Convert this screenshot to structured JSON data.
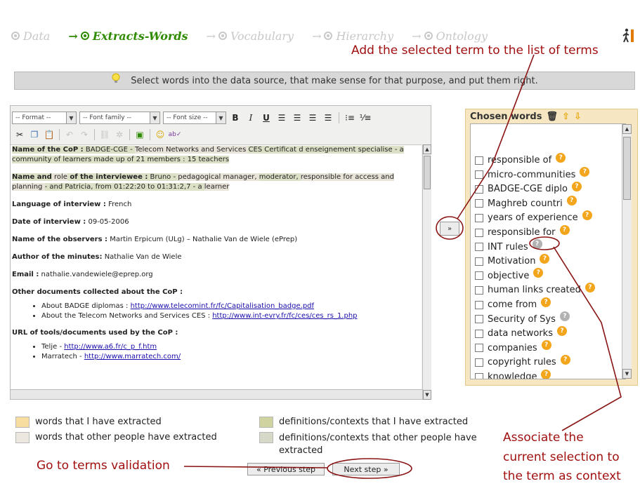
{
  "steps": [
    {
      "label": "Data",
      "arrow": "",
      "active": false
    },
    {
      "label": "Extracts-Words",
      "arrow": "→",
      "active": true
    },
    {
      "label": "Vocabulary",
      "arrow": "→",
      "active": false
    },
    {
      "label": "Hierarchy",
      "arrow": "→",
      "active": false
    },
    {
      "label": "Ontology",
      "arrow": "→",
      "active": false
    }
  ],
  "annotations": {
    "add_term": "Add the selected term to the list of terms",
    "associate_line1": "Associate the",
    "associate_line2": "current selection to",
    "associate_line3": "the term as context",
    "go_validation": "Go to terms validation"
  },
  "hint": {
    "text": "Select words into the data source, that make sense for that purpose, and put them right."
  },
  "editor": {
    "format_select": "-- Format --",
    "font_family_select": "-- Font family --",
    "font_size_select": "-- Font size --",
    "bold": "B",
    "italic": "I",
    "underline": "U"
  },
  "doc": {
    "p1_label": "Name of the CoP :",
    "p1_a": " BADGE-CGE - ",
    "p1_b": " Telecom Networks and Services ",
    "p1_c": " CES Certificat d enseignement specialise - a community of learners made up of 21 members : 15 teachers",
    "p2_label1": "Name and",
    "p2_role": " role",
    "p2_label2": " of the interviewee :",
    "p2_a": " Bruno - ",
    "p2_b": " pedagogical manager, ",
    "p2_c": " moderator, ",
    "p2_d": " responsible for access and planning ",
    "p2_e": " - and Patricia, from 01:22:20 to 01:31:2,7 - a ",
    "p2_f": " learner",
    "p3_label": "Language of interview :",
    "p3_value": " French",
    "p4_label": "Date of interview :",
    "p4_value": " 09-05-2006",
    "p5_label": "Name of the observers :",
    "p5_value": " Martin Erpicum (ULg) – Nathalie Van de Wiele (ePrep)",
    "p6_label": "Author of the minutes:",
    "p6_value": " Nathalie Van de Wiele",
    "p7_label": "Email :",
    "p7_value": " nathalie.vandewiele@eprep.org",
    "p8_label": "Other documents collected about the CoP :",
    "li1_text": "About BADGE diplomas : ",
    "li1_link": "http://www.telecomint.fr/fc/Capitalisation_badge.pdf",
    "li2_text": "About the Telecom Networks and Services CES : ",
    "li2_link": "http://www.int-evry.fr/fc/ces/ces_rs_1.php",
    "p9_label": "URL of tools/documents used by the CoP :",
    "li3_text": "Telje - ",
    "li3_link": "http://www.a6.fr/c_p_f.htm",
    "li4_text": "Marratech - ",
    "li4_link": "http://www.marratech.com/"
  },
  "transfer_button": "»",
  "chosen": {
    "title": "Chosen words",
    "words": [
      {
        "label": "responsible of",
        "icon": "orange"
      },
      {
        "label": "micro-communities",
        "icon": "orange"
      },
      {
        "label": "BADGE-CGE diplo",
        "icon": "orange"
      },
      {
        "label": "Maghreb countri",
        "icon": "orange"
      },
      {
        "label": "years of experience",
        "icon": "orange"
      },
      {
        "label": "responsible for",
        "icon": "orange"
      },
      {
        "label": "INT rules",
        "icon": "grey"
      },
      {
        "label": "Motivation",
        "icon": "orange"
      },
      {
        "label": "objective",
        "icon": "orange"
      },
      {
        "label": "human links created",
        "icon": "orange"
      },
      {
        "label": "come from",
        "icon": "orange"
      },
      {
        "label": "Security of Sys",
        "icon": "grey"
      },
      {
        "label": "data networks",
        "icon": "orange"
      },
      {
        "label": "companies",
        "icon": "orange"
      },
      {
        "label": "copyright rules",
        "icon": "orange"
      },
      {
        "label": "knowledge",
        "icon": "orange"
      }
    ]
  },
  "legend": {
    "mine_words": "words that I have extracted",
    "others_words": "words that other people have extracted",
    "mine_defs": "definitions/contexts that I have extracted",
    "others_defs": "definitions/contexts that other people have extracted"
  },
  "nav": {
    "previous": "« Previous step",
    "next": "Next step »"
  },
  "colors": {
    "mine_words": "#f8dda0",
    "others_words": "#ece7df",
    "mine_defs": "#cfd39f",
    "others_defs": "#d7d9c8",
    "annotation": "#a11010",
    "active_step": "#2f8b00"
  }
}
